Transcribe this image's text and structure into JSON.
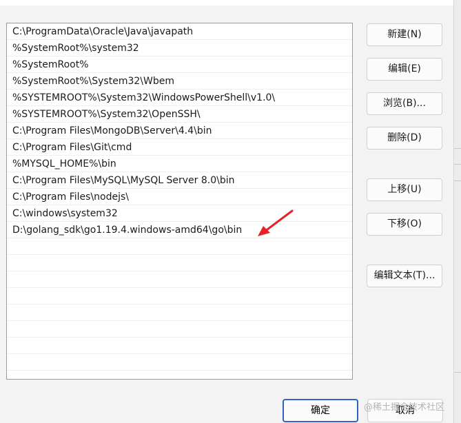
{
  "path_list": {
    "items": [
      "C:\\ProgramData\\Oracle\\Java\\javapath",
      "%SystemRoot%\\system32",
      "%SystemRoot%",
      "%SystemRoot%\\System32\\Wbem",
      "%SYSTEMROOT%\\System32\\WindowsPowerShell\\v1.0\\",
      "%SYSTEMROOT%\\System32\\OpenSSH\\",
      "C:\\Program Files\\MongoDB\\Server\\4.4\\bin",
      "C:\\Program Files\\Git\\cmd",
      "%MYSQL_HOME%\\bin",
      "C:\\Program Files\\MySQL\\MySQL Server 8.0\\bin",
      "C:\\Program Files\\nodejs\\",
      "C:\\windows\\system32",
      "D:\\golang_sdk\\go1.19.4.windows-amd64\\go\\bin"
    ]
  },
  "buttons": {
    "new": "新建(N)",
    "edit": "编辑(E)",
    "browse": "浏览(B)...",
    "delete": "删除(D)",
    "move_up": "上移(U)",
    "move_down": "下移(O)",
    "edit_text": "编辑文本(T)..."
  },
  "footer": {
    "ok": "确定",
    "cancel": "取消"
  },
  "watermark": "@稀土掘金技术社区",
  "colors": {
    "annotation_arrow": "#e8202a",
    "primary_border": "#2b63c6"
  }
}
